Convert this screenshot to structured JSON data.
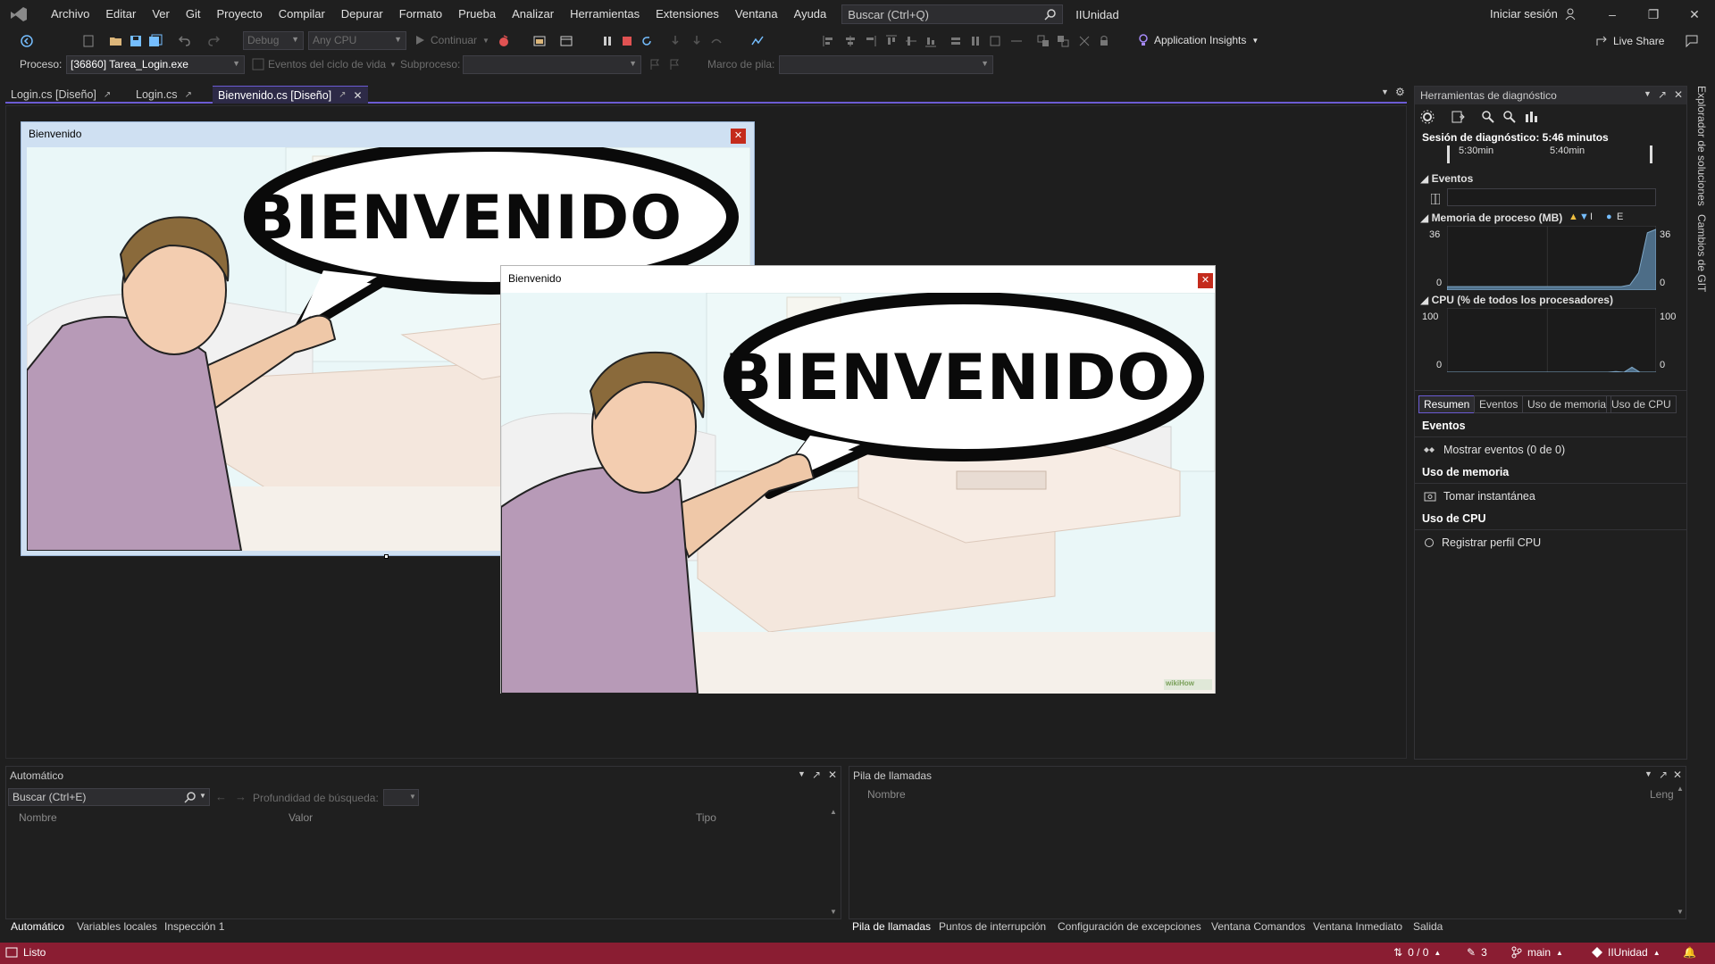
{
  "menubar": {
    "items": [
      "Archivo",
      "Editar",
      "Ver",
      "Git",
      "Proyecto",
      "Compilar",
      "Depurar",
      "Formato",
      "Prueba",
      "Analizar",
      "Herramientas",
      "Extensiones",
      "Ventana",
      "Ayuda"
    ],
    "search_placeholder": "Buscar (Ctrl+Q)",
    "solution_name": "IIUnidad",
    "signin_label": "Iniciar sesión"
  },
  "toolbar": {
    "config": "Debug",
    "platform": "Any CPU",
    "continue_label": "Continuar",
    "app_insights_label": "Application Insights",
    "live_share_label": "Live Share"
  },
  "debugbar": {
    "process_label": "Proceso:",
    "process_value": "[36860] Tarea_Login.exe",
    "lifecycle_label": "Eventos del ciclo de vida",
    "thread_label": "Subproceso:",
    "stackframe_label": "Marco de pila:"
  },
  "doc_tabs": [
    {
      "label": "Login.cs [Diseño]",
      "active": false
    },
    {
      "label": "Login.cs",
      "active": false
    },
    {
      "label": "Bienvenido.cs [Diseño]",
      "active": true
    }
  ],
  "designer": {
    "form_title": "Bienvenido",
    "speech_text": "BIENVENIDO",
    "runtime_title": "Bienvenido",
    "watermark": "wikiHow"
  },
  "diag": {
    "title": "Herramientas de diagnóstico",
    "session": "Sesión de diagnóstico: 5:46 minutos",
    "timeline_labels": [
      "5:30min",
      "5:40min"
    ],
    "events_header": "Eventos",
    "memory_header": "Memoria de proceso (MB)",
    "memory_legend_letter": "I",
    "memory_legend_letter2": "E",
    "memory_max": "36",
    "memory_min": "0",
    "cpu_header": "CPU (% de todos los procesadores)",
    "cpu_max": "100",
    "cpu_min": "0",
    "summary_tabs": [
      "Resumen",
      "Eventos",
      "Uso de memoria",
      "Uso de CPU"
    ],
    "sections": [
      {
        "header": "Eventos",
        "link": "Mostrar eventos (0 de 0)"
      },
      {
        "header": "Uso de memoria",
        "link": "Tomar instantánea"
      },
      {
        "header": "Uso de CPU",
        "link": "Registrar perfil CPU"
      }
    ],
    "memory_series": [
      2,
      2,
      2,
      2,
      2,
      2,
      2,
      2,
      2,
      2,
      2,
      2,
      2,
      2,
      2,
      2,
      2,
      2,
      2,
      2,
      2,
      3,
      10,
      33,
      35
    ],
    "cpu_series": [
      0,
      0,
      0,
      0,
      0,
      0,
      0,
      0,
      0,
      0,
      0,
      0,
      0,
      0,
      0,
      0,
      0,
      0,
      0,
      0,
      0,
      1,
      0,
      8,
      0,
      0,
      0
    ]
  },
  "vstrip": {
    "items": [
      "Explorador de soluciones",
      "Cambios de GIT"
    ]
  },
  "auto_panel": {
    "title": "Automático",
    "search_placeholder": "Buscar (Ctrl+E)",
    "depth_label": "Profundidad de búsqueda:",
    "columns": [
      "Nombre",
      "Valor",
      "Tipo"
    ],
    "tabs": [
      "Automático",
      "Variables locales",
      "Inspección 1"
    ]
  },
  "callstack_panel": {
    "title": "Pila de llamadas",
    "columns": [
      "Nombre",
      "Leng"
    ],
    "tabs": [
      "Pila de llamadas",
      "Puntos de interrupción",
      "Configuración de excepciones",
      "Ventana Comandos",
      "Ventana Inmediato",
      "Salida"
    ]
  },
  "statusbar": {
    "status": "Listo",
    "changes": "0 / 0",
    "edits": "3",
    "branch": "main",
    "repo": "IIUnidad"
  }
}
